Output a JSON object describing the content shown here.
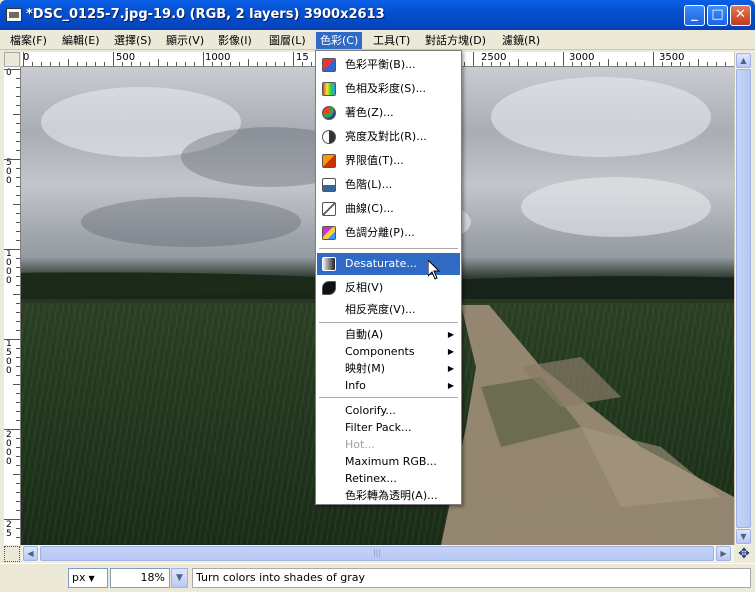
{
  "window": {
    "title": "*DSC_0125-7.jpg-19.0 (RGB, 2 layers) 3900x2613",
    "minimize": "_",
    "maximize": "□",
    "close": "✕"
  },
  "menubar": {
    "items": [
      {
        "label": "檔案(F)"
      },
      {
        "label": "編輯(E)"
      },
      {
        "label": "選擇(S)"
      },
      {
        "label": "顯示(V)"
      },
      {
        "label": "影像(I)"
      },
      {
        "label": "圖層(L)"
      },
      {
        "label": "色彩(C)"
      },
      {
        "label": "工具(T)"
      },
      {
        "label": "對話方塊(D)"
      },
      {
        "label": "濾鏡(R)"
      }
    ],
    "active_index": 6
  },
  "hruler": {
    "labels": [
      "0",
      "500",
      "1000",
      "15",
      "2500",
      "3000",
      "3500"
    ]
  },
  "vruler": {
    "labels": [
      "0",
      "500",
      "1000",
      "1500",
      "2000",
      "25"
    ]
  },
  "color_menu": {
    "items": [
      {
        "label": "色彩平衡(B)...",
        "icon": "color-balance-icon"
      },
      {
        "label": "色相及彩度(S)...",
        "icon": "hue-saturation-icon"
      },
      {
        "label": "著色(Z)...",
        "icon": "colorize-icon"
      },
      {
        "label": "亮度及對比(R)...",
        "icon": "brightness-contrast-icon"
      },
      {
        "label": "界限值(T)...",
        "icon": "threshold-icon"
      },
      {
        "label": "色階(L)...",
        "icon": "levels-icon"
      },
      {
        "label": "曲線(C)...",
        "icon": "curves-icon"
      },
      {
        "label": "色調分離(P)...",
        "icon": "posterize-icon"
      },
      {
        "label": "Desaturate...",
        "icon": "desaturate-icon"
      },
      {
        "label": "反相(V)",
        "icon": "invert-icon"
      },
      {
        "label": "相反亮度(V)..."
      },
      {
        "label": "自動(A)",
        "submenu": true
      },
      {
        "label": "Components",
        "submenu": true
      },
      {
        "label": "映射(M)",
        "submenu": true
      },
      {
        "label": "Info",
        "submenu": true
      },
      {
        "label": "Colorify..."
      },
      {
        "label": "Filter Pack..."
      },
      {
        "label": "Hot...",
        "disabled": true
      },
      {
        "label": "Maximum RGB..."
      },
      {
        "label": "Retinex..."
      },
      {
        "label": "色彩轉為透明(A)..."
      }
    ],
    "highlighted_index": 8
  },
  "statusbar": {
    "unit": "px",
    "zoom": "18%",
    "message": "Turn colors into shades of gray"
  }
}
